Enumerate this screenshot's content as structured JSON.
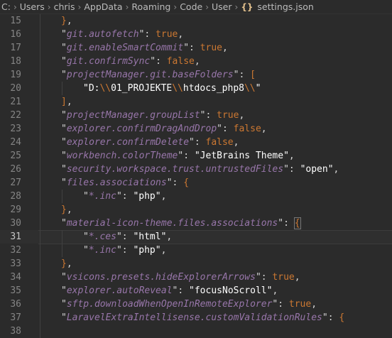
{
  "breadcrumb": {
    "segments": [
      "C:",
      "Users",
      "chris",
      "AppData",
      "Roaming",
      "Code",
      "User"
    ],
    "file_icon": "{}",
    "file": "settings.json"
  },
  "editor": {
    "current_line": 31,
    "lines": [
      {
        "n": "15",
        "code": "},"
      },
      {
        "n": "16",
        "code": "\"git.autofetch\": true,"
      },
      {
        "n": "17",
        "code": "\"git.enableSmartCommit\": true,"
      },
      {
        "n": "18",
        "code": "\"git.confirmSync\": false,"
      },
      {
        "n": "19",
        "code": "\"projectManager.git.baseFolders\": ["
      },
      {
        "n": "20",
        "code": "\"D:\\\\01_PROJEKTE\\\\htdocs_php8\\\\\""
      },
      {
        "n": "21",
        "code": "],"
      },
      {
        "n": "22",
        "code": "\"projectManager.groupList\": true,"
      },
      {
        "n": "23",
        "code": "\"explorer.confirmDragAndDrop\": false,"
      },
      {
        "n": "24",
        "code": "\"explorer.confirmDelete\": false,"
      },
      {
        "n": "25",
        "code": "\"workbench.colorTheme\": \"JetBrains Theme\","
      },
      {
        "n": "26",
        "code": "\"security.workspace.trust.untrustedFiles\": \"open\","
      },
      {
        "n": "27",
        "code": "\"files.associations\": {"
      },
      {
        "n": "28",
        "code": "\"*.inc\": \"php\","
      },
      {
        "n": "29",
        "code": "},"
      },
      {
        "n": "30",
        "code": "\"material-icon-theme.files.associations\": {"
      },
      {
        "n": "31",
        "code": "\"*.ces\": \"html\","
      },
      {
        "n": "32",
        "code": "\"*.inc\": \"php\","
      },
      {
        "n": "33",
        "code": "},"
      },
      {
        "n": "34",
        "code": "\"vsicons.presets.hideExplorerArrows\": true,"
      },
      {
        "n": "35",
        "code": "\"explorer.autoReveal\": \"focusNoScroll\","
      },
      {
        "n": "36",
        "code": "\"sftp.downloadWhenOpenInRemoteExplorer\": true,"
      },
      {
        "n": "37",
        "code": "\"LaravelExtraIntellisense.customValidationRules\": {"
      },
      {
        "n": "38",
        "code": ""
      }
    ]
  },
  "colors": {
    "background": "#2b2b2b",
    "key": "#9876aa",
    "string": "#ffffff",
    "keyword": "#cc7832",
    "line_number": "#858585"
  }
}
